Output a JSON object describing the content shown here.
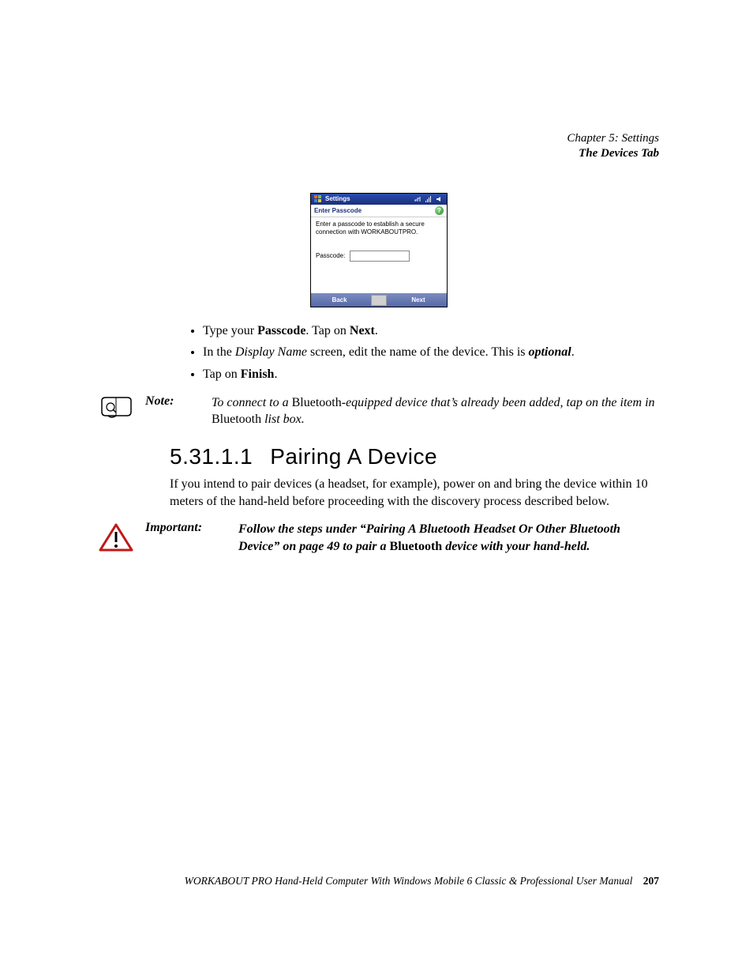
{
  "running_head": {
    "chapter": "Chapter 5: Settings",
    "section": "The Devices Tab"
  },
  "device_screenshot": {
    "titlebar": "Settings",
    "subheader": "Enter Passcode",
    "helper_text": "Enter a passcode to establish a secure connection with WORKABOUTPRO.",
    "field_label": "Passcode:",
    "field_value": "",
    "help_symbol": "?",
    "footer": {
      "back": "Back",
      "next": "Next"
    }
  },
  "bullets": [
    {
      "pre": "Type your ",
      "bold": "Passcode",
      "mid": ". Tap on ",
      "bold2": "Next",
      "post": "."
    },
    {
      "pre": "In the ",
      "ital": "Display Name",
      "mid": " screen, edit the name of the device. This is ",
      "bi": "optional",
      "post": "."
    },
    {
      "pre": "Tap on ",
      "bold": "Finish",
      "post": "."
    }
  ],
  "note": {
    "label": "Note:",
    "body_pre": "To connect to a ",
    "body_r1": "Bluetooth",
    "body_mid": "-equipped device that’s already been added, tap on the item in ",
    "body_r2": "Bluetooth",
    "body_post": " list box."
  },
  "section": {
    "number": "5.31.1.1",
    "title": "Pairing A Device",
    "body": "If you intend to pair devices (a headset, for example), power on and bring the device within 10 meters of the hand-held before proceeding with the discovery process described below."
  },
  "important": {
    "label": "Important:",
    "line1_a": "Follow the steps under “Pairing A Bluetooth Headset Or Other Bluetooth Device” on page 49 to pair a ",
    "line1_b": "Bluetooth",
    "line1_c": " device with your hand-held."
  },
  "footer": {
    "text": "WORKABOUT PRO Hand-Held Computer With Windows Mobile 6 Classic & Professional User Manual",
    "page": "207"
  }
}
